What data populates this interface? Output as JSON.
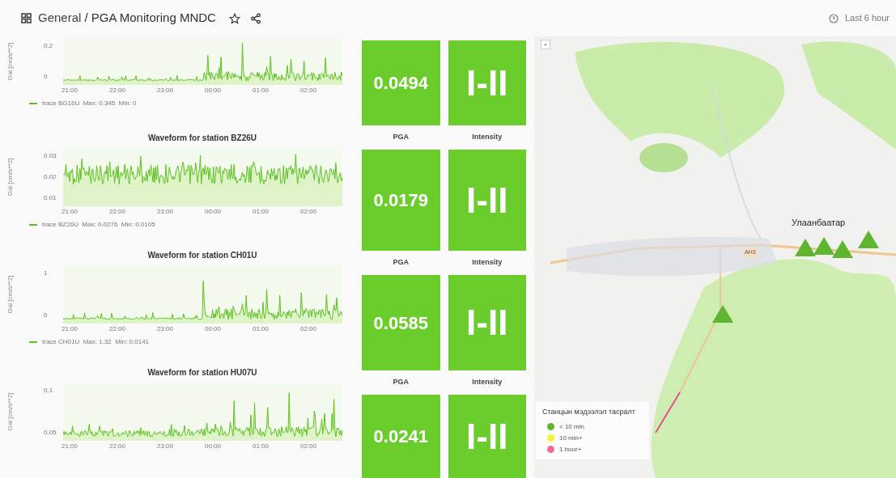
{
  "header": {
    "folder": "General",
    "title": "/ PGA Monitoring MNDC",
    "time_range": "Last 6 hour"
  },
  "waveforms": [
    {
      "y_label": "Gal [cm/s**2]",
      "y_ticks": [
        "0.2",
        "0"
      ],
      "x_ticks": [
        "21:00",
        "22:00",
        "23:00",
        "00:00",
        "01:00",
        "02:00"
      ],
      "legend": "trace BG16U  Max: 0.345  Min: 0"
    },
    {
      "title": "Waveform for station BZ26U",
      "y_label": "Gal [cm/s**2]",
      "y_ticks": [
        "0.03",
        "0.02",
        "0.01"
      ],
      "x_ticks": [
        "21:00",
        "22:00",
        "23:00",
        "00:00",
        "01:00",
        "02:00"
      ],
      "legend": "trace BZ26U  Max: 0.0276  Min: 0.0105"
    },
    {
      "title": "Waveform for station CH01U",
      "y_label": "Gal [cm/s**2]",
      "y_ticks": [
        "1",
        "0"
      ],
      "x_ticks": [
        "21:00",
        "22:00",
        "23:00",
        "00:00",
        "01:00",
        "02:00"
      ],
      "legend": "trace CH01U  Max: 1.32  Min: 0.0141"
    },
    {
      "title": "Waveform for station HU07U",
      "y_label": "Gal [cm/s**2]",
      "y_ticks": [
        "0.1",
        "0.05"
      ],
      "x_ticks": [
        "21:00",
        "22:00",
        "23:00",
        "00:00",
        "01:00",
        "02:00"
      ]
    }
  ],
  "stats": [
    {
      "pga": "0.0494",
      "intensity": "I-II"
    },
    {
      "pga_label": "PGA",
      "intensity_label": "Intensity",
      "pga": "0.0179",
      "intensity": "I-II"
    },
    {
      "pga_label": "PGA",
      "intensity_label": "Intensity",
      "pga": "0.0585",
      "intensity": "I-II"
    },
    {
      "pga_label": "PGA",
      "intensity_label": "Intensity",
      "pga": "0.0241",
      "intensity": "I-II"
    }
  ],
  "map": {
    "zoom_out": "-",
    "city": "Улаанбаатар",
    "road": "AH3",
    "stations": [
      {
        "color": "#5fb52f"
      },
      {
        "color": "#5fb52f"
      },
      {
        "color": "#5fb52f"
      },
      {
        "color": "#5fb52f"
      },
      {
        "color": "#5fb52f"
      }
    ],
    "legend": {
      "title": "Станцын мэдээлэл тасралт",
      "items": [
        {
          "label": "< 10 min",
          "color": "#5fb52f"
        },
        {
          "label": "10 min+",
          "color": "#f2f23a"
        },
        {
          "label": "1 hour+",
          "color": "#f06a9a"
        }
      ]
    }
  }
}
